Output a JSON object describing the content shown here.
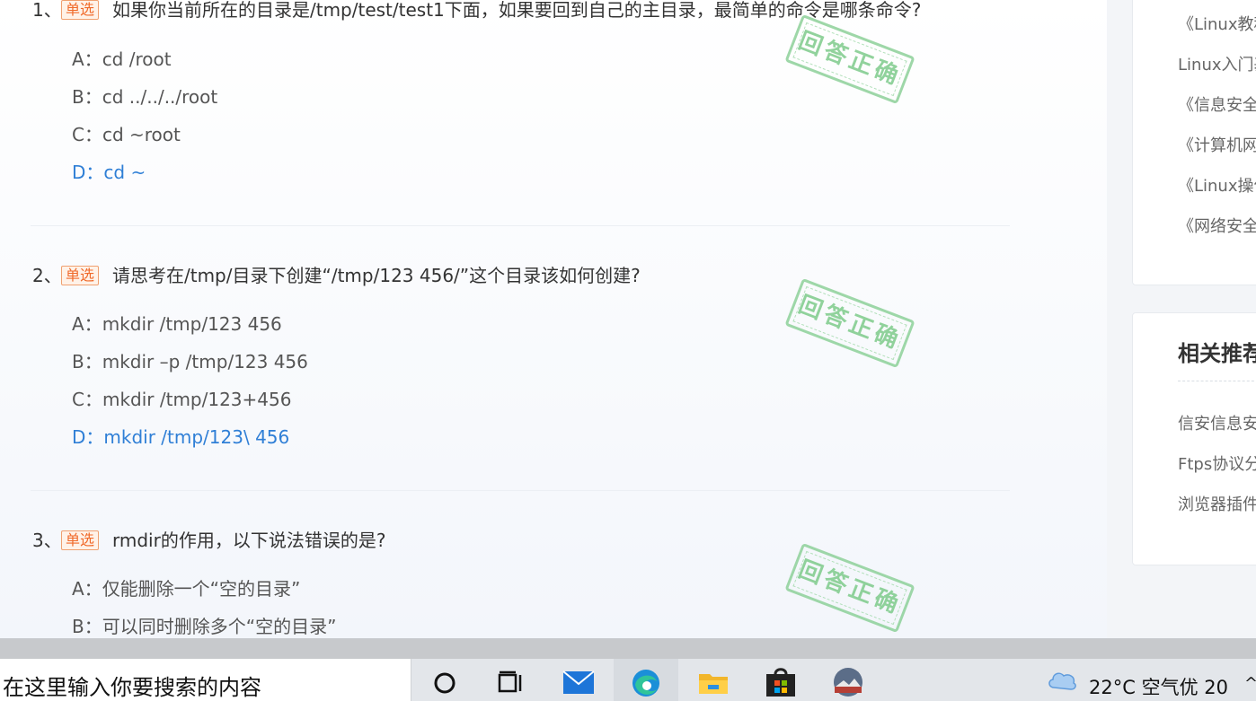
{
  "questions": [
    {
      "number": "1、",
      "badge": "单选",
      "text": "如果你当前所在的目录是/tmp/test/test1下面，如果要回到自己的主目录，最简单的命令是哪条命令?",
      "options": [
        {
          "label": "A：",
          "text": "cd /root",
          "correct": false
        },
        {
          "label": "B：",
          "text": "cd ../../../root",
          "correct": false
        },
        {
          "label": "C：",
          "text": "cd ~root",
          "correct": false
        },
        {
          "label": "D：",
          "text": "cd ~",
          "correct": true
        }
      ],
      "stamp": "回答正确"
    },
    {
      "number": "2、",
      "badge": "单选",
      "text": "请思考在/tmp/目录下创建“/tmp/123 456/”这个目录该如何创建?",
      "options": [
        {
          "label": "A：",
          "text": "mkdir /tmp/123 456",
          "correct": false
        },
        {
          "label": "B：",
          "text": "mkdir –p /tmp/123 456",
          "correct": false
        },
        {
          "label": "C：",
          "text": "mkdir /tmp/123+456",
          "correct": false
        },
        {
          "label": "D：",
          "text": "mkdir /tmp/123\\ 456",
          "correct": true
        }
      ],
      "stamp": "回答正确"
    },
    {
      "number": "3、",
      "badge": "单选",
      "text": "rmdir的作用，以下说法错误的是?",
      "options": [
        {
          "label": "A：",
          "text": "仅能删除一个“空的目录”",
          "correct": false
        },
        {
          "label": "B：",
          "text": "可以同时删除多个“空的目录”",
          "correct": false
        }
      ],
      "stamp": "回答正确"
    }
  ],
  "sidebar": {
    "links": [
      "《Linux教程",
      "Linux入门基",
      "《信息安全",
      "《计算机网",
      "《Linux操作",
      "《网络安全"
    ],
    "related_title": "相关推荐",
    "related": [
      "信安信息安",
      "Ftps协议分",
      "浏览器插件"
    ]
  },
  "taskbar": {
    "search_placeholder": "在这里输入你要搜索的内容",
    "temperature": "22°C",
    "air_quality": "空气优 20",
    "tray_arrow": "^",
    "icons": [
      "cortana-icon",
      "task-view-icon",
      "mail-icon",
      "edge-icon",
      "file-explorer-icon",
      "store-icon",
      "photo-icon"
    ]
  },
  "colors": {
    "correct": "#2f7fd6",
    "badge": "#f06a2a",
    "stamp": "#7ecb8b"
  }
}
